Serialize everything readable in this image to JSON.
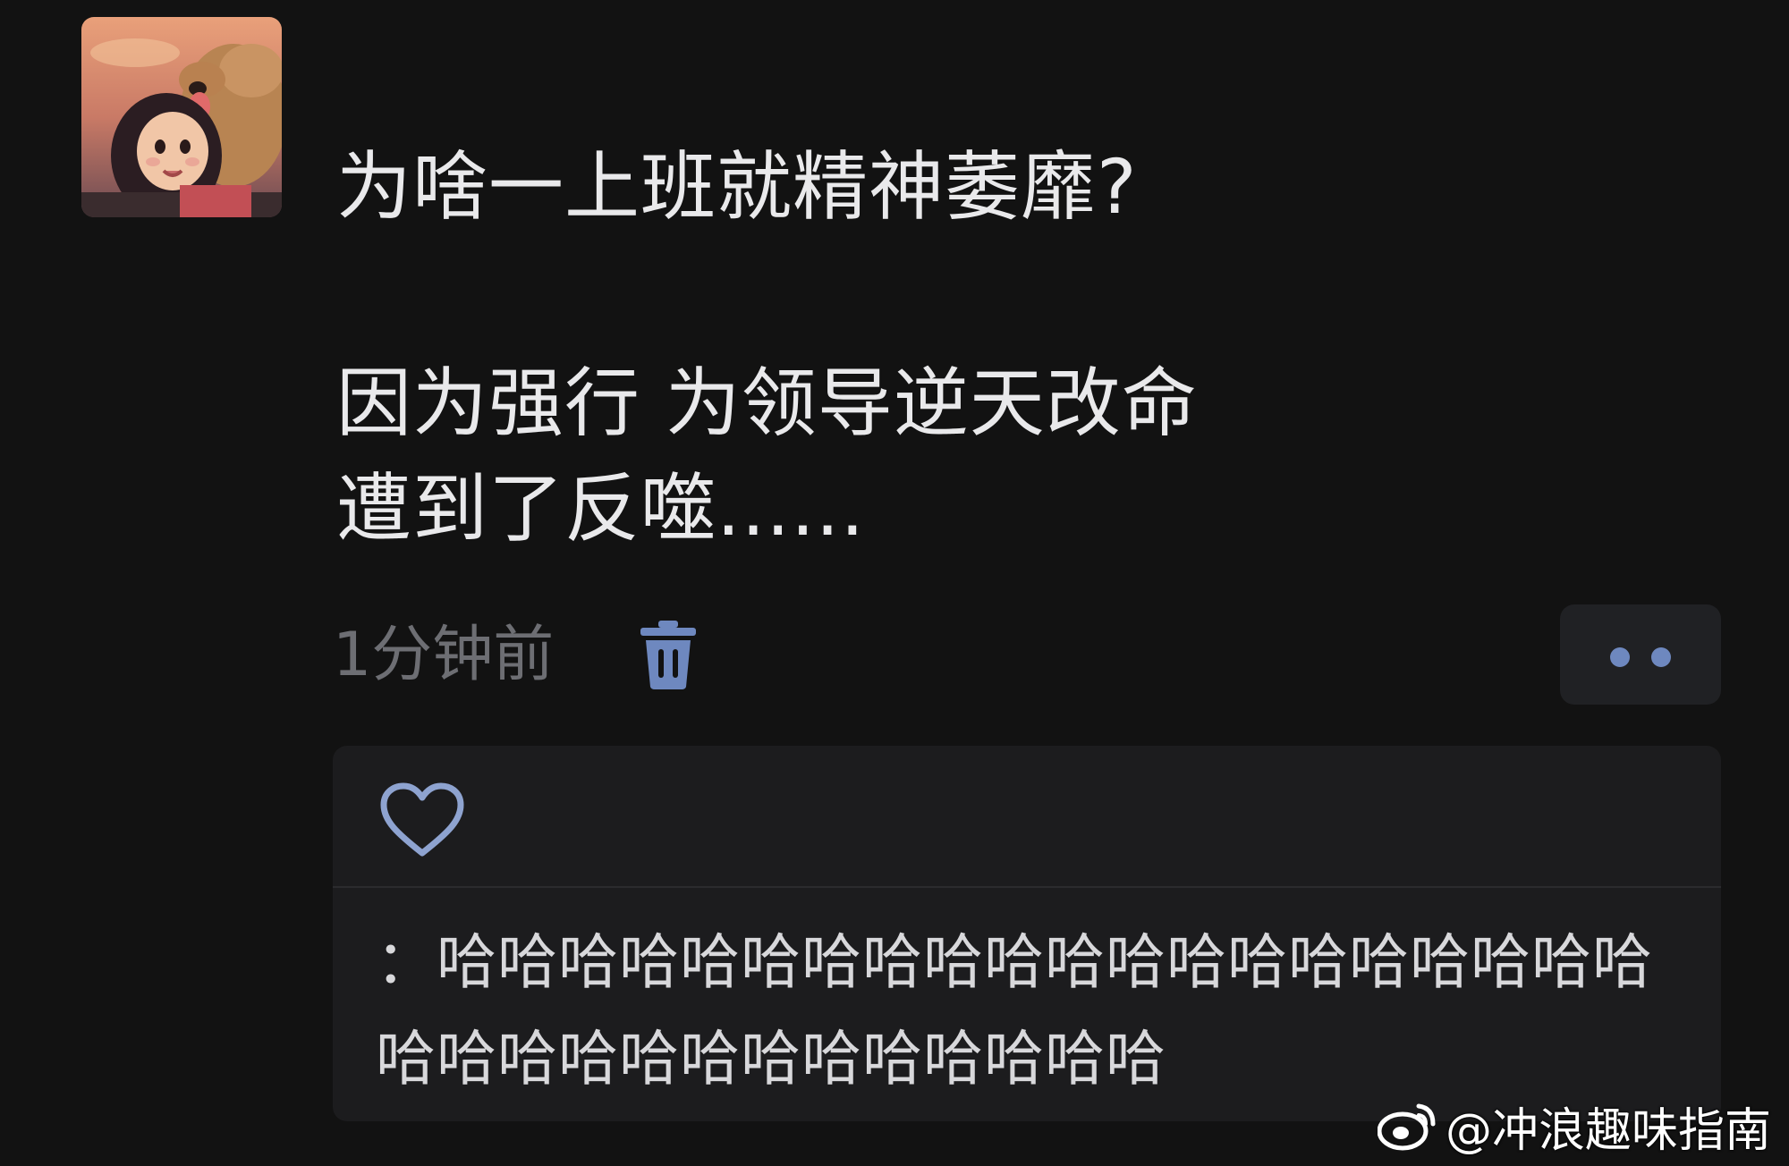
{
  "post": {
    "question": "为啥一上班就精神萎靡?",
    "answer_line1": "因为强行 为领导逆天改命",
    "answer_line2": "遭到了反噬......",
    "timestamp": "1分钟前",
    "icons": [
      "avatar",
      "trash-icon",
      "more-icon"
    ]
  },
  "reactions": {
    "like_icon": "heart-icon",
    "comment_text": "：哈哈哈哈哈哈哈哈哈哈哈哈哈哈哈哈哈哈哈哈哈哈哈哈哈哈哈哈哈哈哈哈哈"
  },
  "watermark": {
    "handle": "@冲浪趣味指南",
    "icon": "weibo-logo-icon"
  },
  "colors": {
    "background": "#121212",
    "panel": "#1c1c1e",
    "accent": "#6e88bf",
    "muted_text": "#6d6e73"
  }
}
